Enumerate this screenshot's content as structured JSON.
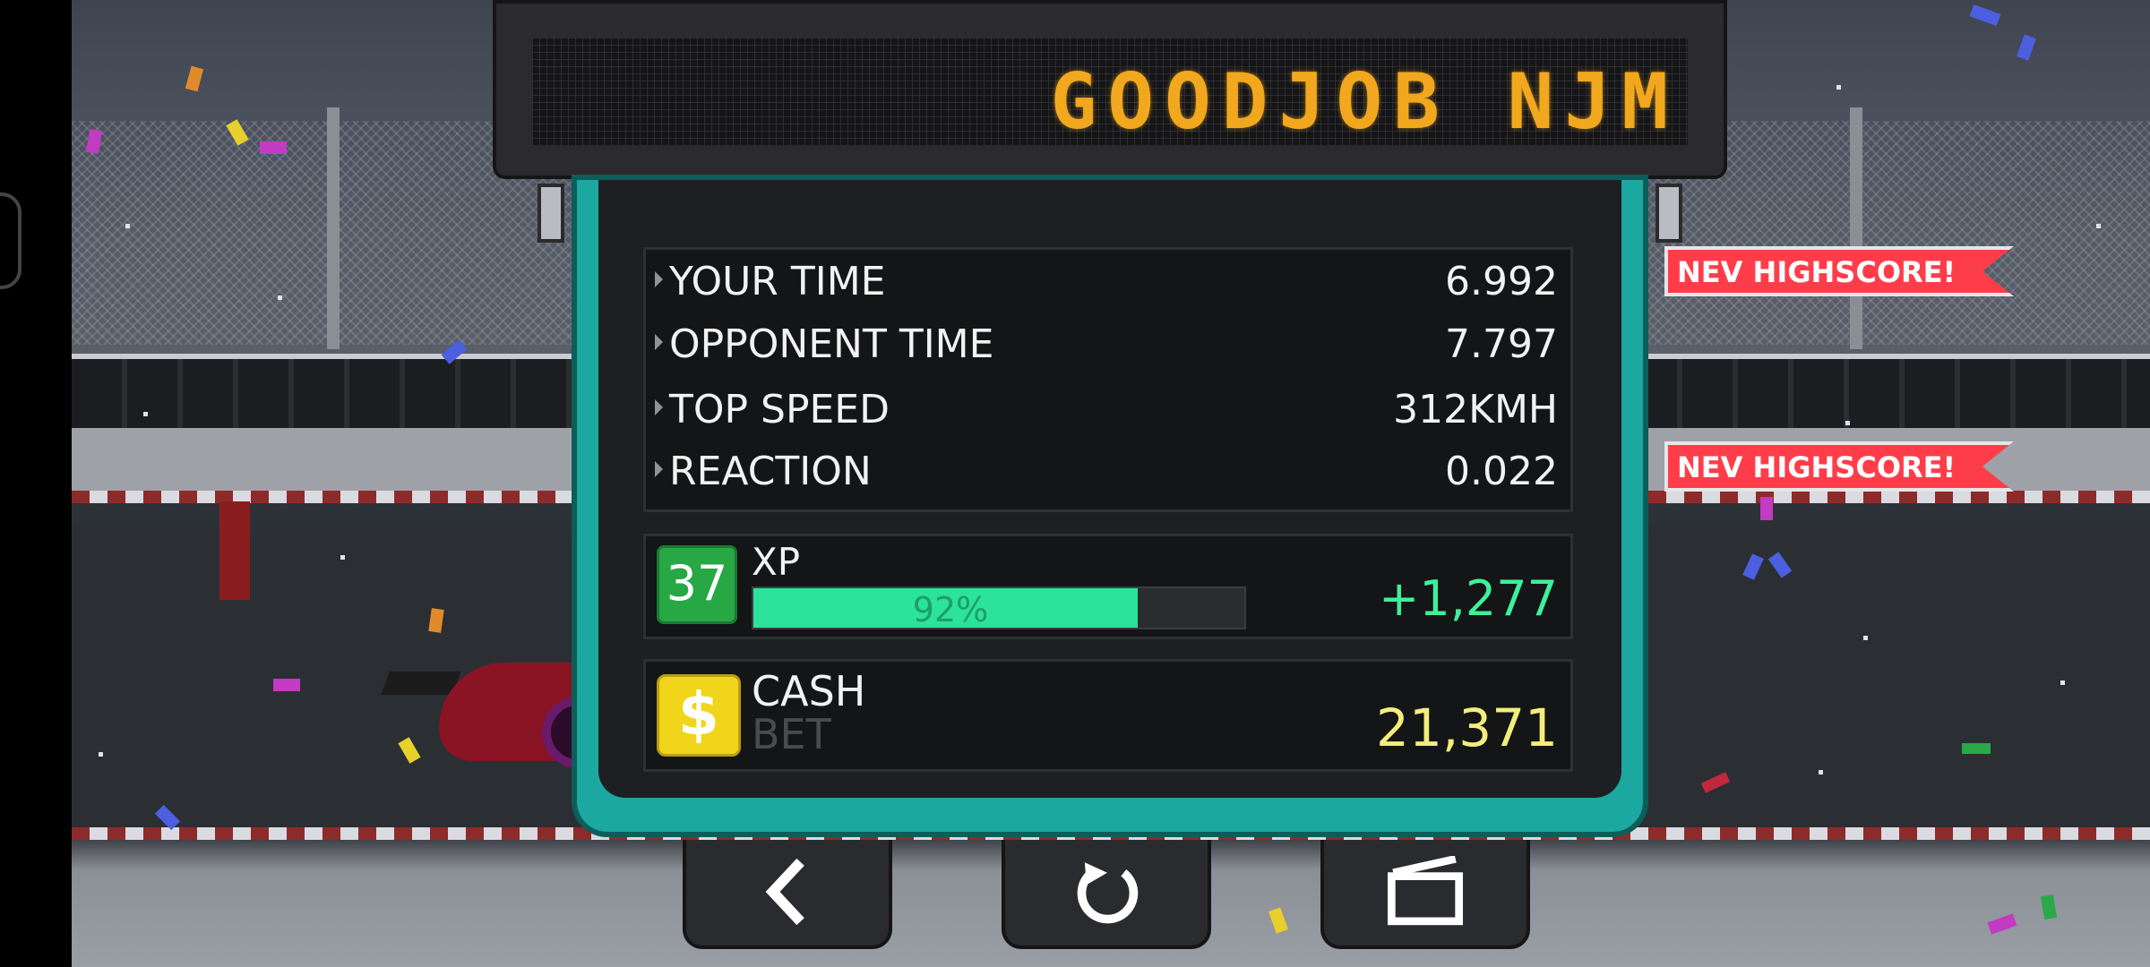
{
  "sign": {
    "text": "GOODJOB NJM"
  },
  "stats": [
    {
      "label": "YOUR TIME",
      "value": "6.992"
    },
    {
      "label": "OPPONENT TIME",
      "value": "7.797"
    },
    {
      "label": "TOP SPEED",
      "value": "312KMH"
    },
    {
      "label": "REACTION",
      "value": "0.022"
    }
  ],
  "badges": [
    "NEV HIGHSCORE!",
    "NEV HIGHSCORE!"
  ],
  "xp": {
    "level": "37",
    "label": "XP",
    "progress_percent": 92,
    "progress_text": "92%",
    "gain": "+1,277"
  },
  "cash": {
    "icon": "$",
    "label": "CASH",
    "sublabel": "BET",
    "value": "21,371"
  },
  "buttons": {
    "back_icon": "back-chevron-icon",
    "restart_icon": "restart-icon",
    "replay_icon": "camera-replay-icon"
  },
  "colors": {
    "panel_teal": "#1aa8a0",
    "xp_green": "#2be39a",
    "cash_yellow": "#f0d51b",
    "badge_red": "#ff3d4a",
    "sign_amber": "#f2a81e"
  }
}
